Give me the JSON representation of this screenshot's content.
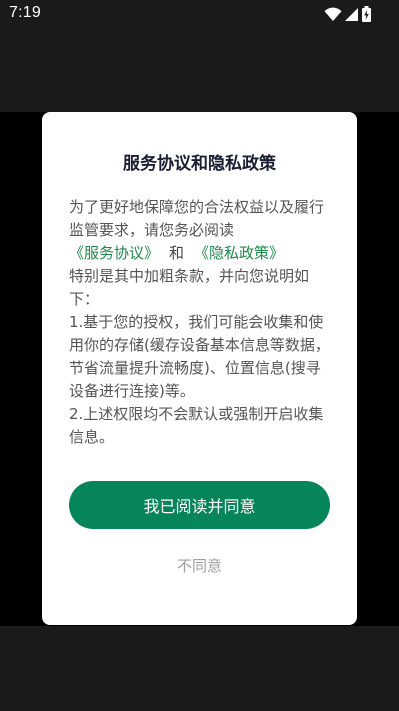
{
  "status_bar": {
    "time": "7:19",
    "icons": [
      "wifi-icon",
      "cellular-signal-icon",
      "battery-charging-icon"
    ]
  },
  "dialog": {
    "title": "服务协议和隐私政策",
    "intro": "为了更好地保障您的合法权益以及履行监管要求，请您务必阅读",
    "service_link": "《服务协议》",
    "and_text": "和",
    "privacy_link": "《隐私政策》",
    "paragraph_1": "特别是其中加粗条款，并向您说明如下：",
    "paragraph_2": "1.基于您的授权，我们可能会收集和使用你的存储(缓存设备基本信息等数据，节省流量提升流畅度)、位置信息(搜寻设备进行连接)等。",
    "paragraph_3": "2.上述权限均不会默认或强制开启收集信息。",
    "agree_label": "我已阅读并同意",
    "disagree_label": "不同意"
  },
  "colors": {
    "accent": "#07855a",
    "link": "#1e8a4c",
    "title": "#1a1f33",
    "body_text": "#555555",
    "muted": "#a0a0a0"
  }
}
